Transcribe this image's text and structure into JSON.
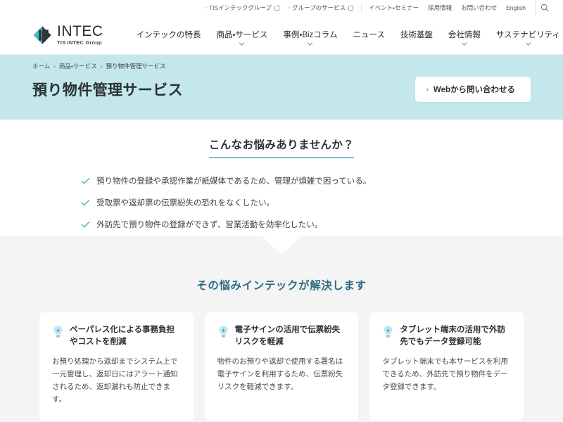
{
  "utility_bar": {
    "links": [
      {
        "label": "TISインテックグループ",
        "icon": "external-link-icon",
        "chevron": "›"
      },
      {
        "label": "グループのサービス",
        "icon": "external-link-icon",
        "chevron": "›"
      }
    ],
    "plain_links": [
      {
        "label": "イベント・セミナー"
      },
      {
        "label": "採用情報"
      },
      {
        "label": "お問い合わせ"
      },
      {
        "label": "English"
      }
    ],
    "search_icon": "search-icon"
  },
  "header": {
    "logo": {
      "word": "INTEC",
      "tagline": "TIS INTEC Group",
      "mark_icon": "intec-diamond-logo-icon",
      "mark_color_left": "#4bb6c6",
      "mark_color_right": "#2e3538"
    },
    "nav": [
      {
        "label": "インテックの特長",
        "has_dropdown": false
      },
      {
        "label": "商品・サービス",
        "has_dropdown": true
      },
      {
        "label": "事例・Bizコラム",
        "has_dropdown": true
      },
      {
        "label": "ニュース",
        "has_dropdown": false
      },
      {
        "label": "技術基盤",
        "has_dropdown": false
      },
      {
        "label": "会社情報",
        "has_dropdown": true
      },
      {
        "label": "サステナビリティ",
        "has_dropdown": true
      }
    ]
  },
  "hero": {
    "background_color": "#c3e7ea",
    "breadcrumb": [
      {
        "label": "ホーム",
        "current": false
      },
      {
        "label": "商品・サービス",
        "current": false
      },
      {
        "label": "預り物件管理サービス",
        "current": true
      }
    ],
    "breadcrumb_separator": "›",
    "title": "預り物件管理サービス",
    "cta": {
      "label": "Webから問い合わせる",
      "chevron": "›",
      "chevron_color": "#4ab3c0"
    }
  },
  "problems": {
    "heading": "こんなお悩みありませんか？",
    "underline_color": "#7cc1cc",
    "check_icon": "check-icon",
    "check_color": "#59b9c6",
    "items": [
      "預り物件の登録や承認作業が紙媒体であるため、管理が煩雑で困っている。",
      "受取票や返却票の伝票紛失の恐れをなくしたい。",
      "外訪先で預り物件の登録ができず、営業活動を効率化したい。"
    ]
  },
  "solutions": {
    "background_color": "#f4f4f5",
    "heading": "その悩みインテックが解決します",
    "heading_color": "#2f6b80",
    "notch_icon": "down-triangle-notch-icon",
    "cards": [
      {
        "icon": "lightbulb-icon",
        "title": "ペーパレス化による事務負担やコストを削減",
        "body": "お預り処理から返却までシステム上で一元管理し、返却日にはアラート通知されるため、返却漏れも防止できます。"
      },
      {
        "icon": "lightbulb-icon",
        "title": "電子サインの活用で伝票紛失リスクを軽減",
        "body": "物件のお預りや返却で使用する署名は電子サインを利用するため、伝票紛失リスクを軽減できます。"
      },
      {
        "icon": "lightbulb-icon",
        "title": "タブレット端末の活用で外訪先でもデータ登録可能",
        "body": "タブレット端末でも本サービスを利用できるため、外訪先で預り物件をデータ登録できます。"
      }
    ]
  }
}
